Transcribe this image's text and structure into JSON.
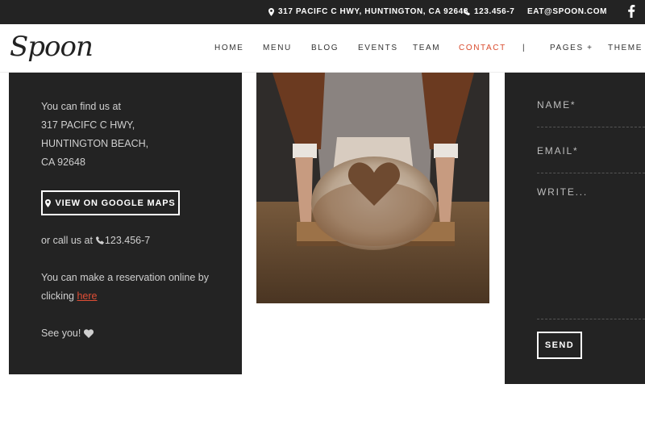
{
  "topbar": {
    "address": "317 PACIFC C HWY, HUNTINGTON, CA 92648",
    "phone": "123.456-7",
    "email": "EAT@SPOON.COM"
  },
  "brand": {
    "logo": "Spoon"
  },
  "nav": {
    "items": [
      {
        "label": "HOME"
      },
      {
        "label": "MENU"
      },
      {
        "label": "BLOG"
      },
      {
        "label": "EVENTS"
      },
      {
        "label": "TEAM"
      },
      {
        "label": "CONTACT",
        "active": true
      },
      {
        "label": "|"
      },
      {
        "label": "PAGES +"
      },
      {
        "label": "THEME F"
      }
    ],
    "active_color": "#d94a2c"
  },
  "contact_card": {
    "lines": [
      "You can find us at",
      "317 PACIFC C HWY,",
      "HUNTINGTON BEACH,",
      "CA 92648"
    ],
    "maps_button": "VIEW ON GOOGLE MAPS",
    "call_prefix": "or call us at",
    "call_number": "123.456-7",
    "reservation_line1": "You can make a reservation online by",
    "reservation_prefix": "clicking",
    "reservation_link": "here",
    "signoff": "See you!"
  },
  "form": {
    "name_placeholder": "NAME*",
    "email_placeholder": "EMAIL*",
    "message_placeholder": "WRITE...",
    "send_label": "SEND"
  },
  "colors": {
    "dark": "#232323",
    "accent": "#d94a2c",
    "white": "#ffffff"
  },
  "icons": [
    "map-pin-icon",
    "phone-icon",
    "facebook-icon",
    "heart-icon"
  ]
}
